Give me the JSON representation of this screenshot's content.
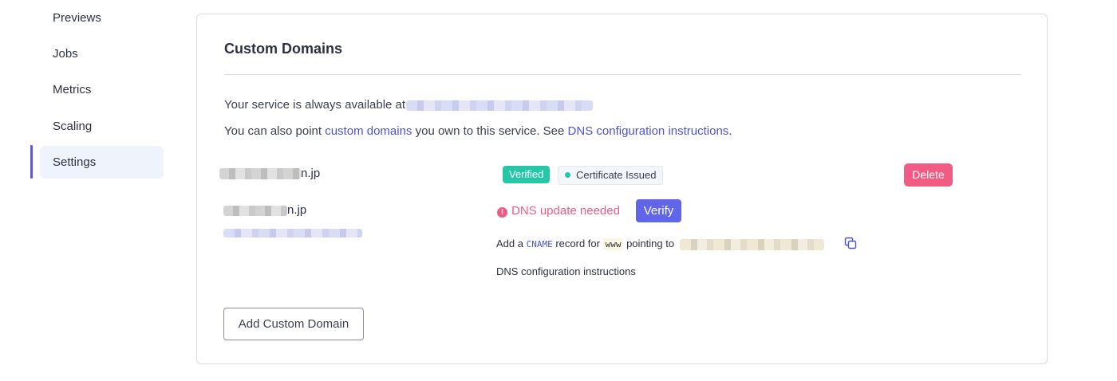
{
  "sidebar": {
    "items": [
      {
        "label": "Previews"
      },
      {
        "label": "Jobs"
      },
      {
        "label": "Metrics"
      },
      {
        "label": "Scaling"
      },
      {
        "label": "Settings",
        "active": true
      }
    ]
  },
  "card": {
    "title": "Custom Domains",
    "availability": {
      "prefix": "Your service is always available at"
    },
    "point": {
      "prefix": "You can also point ",
      "link1": "custom domains",
      "middle": " you own to this service. See ",
      "link2": "DNS configuration instructions",
      "suffix": "."
    },
    "domains": [
      {
        "name_suffix": "n.jp",
        "status_badge": "Verified",
        "certificate_badge": "Certificate Issued",
        "delete_label": "Delete"
      },
      {
        "name_suffix": "n.jp",
        "warning": "DNS update needed",
        "verify_label": "Verify",
        "cname": {
          "prefix": "Add a ",
          "record_type": "CNAME",
          "middle": " record for ",
          "host": "www",
          "suffix": " pointing to "
        },
        "instructions": "DNS configuration instructions"
      }
    ],
    "add_button": "Add Custom Domain"
  },
  "colors": {
    "accent": "#5b5bd6",
    "link": "#4b55d4",
    "verified": "#25c7a8",
    "danger": "#f25b83",
    "warning": "#ee5a86",
    "verify_button": "#6166e9"
  },
  "icons": {
    "warning": "exclamation-circle-icon",
    "copy": "copy-icon",
    "status_dot": "status-dot-icon"
  }
}
